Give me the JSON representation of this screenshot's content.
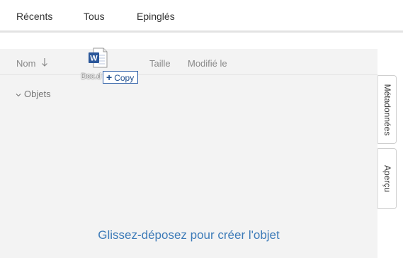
{
  "tabs": {
    "recent": "Récents",
    "all": "Tous",
    "pinned": "Epinglés"
  },
  "columns": {
    "name": "Nom",
    "size": "Taille",
    "modified": "Modifié le",
    "sort_direction": "descending"
  },
  "group": {
    "label": "Objets",
    "icon": "chevron-down-icon"
  },
  "drop_hint": "Glissez-déposez pour créer l'objet",
  "side_tabs": {
    "metadata": "Métadonnées",
    "preview": "Aperçu"
  },
  "drag": {
    "file_icon": "word-document-icon",
    "filename": "Doc.d",
    "badge_plus": "+",
    "badge_label": "Copy"
  },
  "colors": {
    "accent": "#3d7bb8",
    "word_blue": "#2b579a",
    "panel_bg": "#f3f3f3",
    "badge_border": "#2c5ea8"
  }
}
